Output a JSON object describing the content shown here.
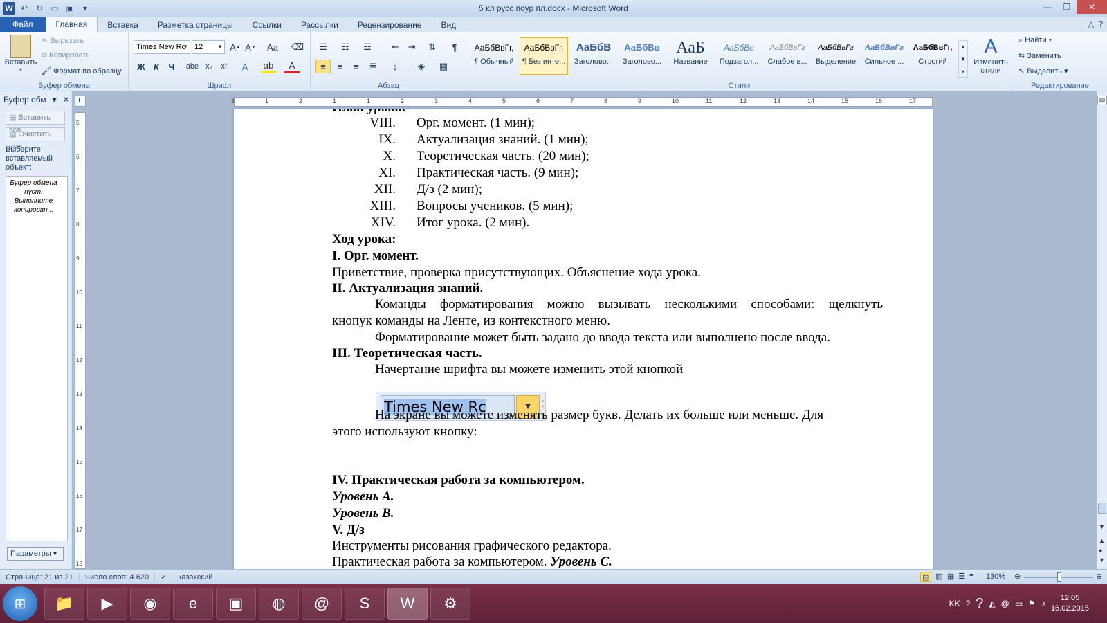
{
  "window": {
    "title": "5 кл русс поур пл.docx - Microsoft Word",
    "app_icon": "W"
  },
  "tabs": [
    {
      "label": "Файл"
    },
    {
      "label": "Главная"
    },
    {
      "label": "Вставка"
    },
    {
      "label": "Разметка страницы"
    },
    {
      "label": "Ссылки"
    },
    {
      "label": "Рассылки"
    },
    {
      "label": "Рецензирование"
    },
    {
      "label": "Вид"
    }
  ],
  "ribbon": {
    "clipboard": {
      "paste": "Вставить",
      "cut": "Вырезать",
      "copy": "Копировать",
      "format_painter": "Формат по образцу",
      "label": "Буфер обмена"
    },
    "font": {
      "name": "Times New Rc",
      "size": "12",
      "bold": "Ж",
      "italic": "К",
      "underline": "Ч",
      "strike": "abe",
      "sub": "x₂",
      "sup": "x²",
      "label": "Шрифт"
    },
    "paragraph": {
      "label": "Абзац"
    },
    "styles": {
      "items": [
        {
          "sample": "АаБбВвГг,",
          "name": "¶ Обычный"
        },
        {
          "sample": "АаБбВвГг,",
          "name": "¶ Без инте..."
        },
        {
          "sample": "АаБбВ",
          "name": "Заголово..."
        },
        {
          "sample": "АаБбВв",
          "name": "Заголово..."
        },
        {
          "sample": "АаБ",
          "name": "Название"
        },
        {
          "sample": "АаБбВе",
          "name": "Подзагол..."
        },
        {
          "sample": "АаБбВвГг",
          "name": "Слабое в..."
        },
        {
          "sample": "АаБбВвГг",
          "name": "Выделение"
        },
        {
          "sample": "АаБбВвГг",
          "name": "Сильное ..."
        },
        {
          "sample": "АаБбВвГг,",
          "name": "Строгий"
        }
      ],
      "change": "Изменить стили",
      "label": "Стили"
    },
    "editing": {
      "find": "Найти",
      "replace": "Заменить",
      "select": "Выделить",
      "label": "Редактирование"
    }
  },
  "pane": {
    "title": "Буфер обм",
    "paste_all": "Вставить все",
    "clear_all": "Очистить все",
    "hint": "Выберите вставляемый объект:",
    "empty": "Буфер обмена пуст. Выполните копирован...",
    "params": "Параметры"
  },
  "ruler": {
    "h_labels": [
      "3",
      "1",
      "2",
      "1",
      "1",
      "2",
      "3",
      "4",
      "5",
      "6",
      "7",
      "8",
      "9",
      "10",
      "11",
      "12",
      "13",
      "14",
      "15",
      "16",
      "17"
    ],
    "v_labels": [
      "5",
      "6",
      "7",
      "8",
      "9",
      "10",
      "11",
      "12",
      "13",
      "14",
      "15",
      "16",
      "17",
      "18"
    ]
  },
  "document": {
    "top_cut": "План урока:",
    "plan": [
      {
        "num": "VIII.",
        "text": "Орг. момент. (1 мин);"
      },
      {
        "num": "IX.",
        "text": "Актуализация знаний. (1 мин);"
      },
      {
        "num": "X.",
        "text": "Теоретическая часть. (20 мин);"
      },
      {
        "num": "XI.",
        "text": "Практическая часть. (9 мин);"
      },
      {
        "num": "XII.",
        "text": "Д/з (2 мин);"
      },
      {
        "num": "XIII.",
        "text": "Вопросы учеников. (5 мин);"
      },
      {
        "num": "XIV.",
        "text": "Итог урока. (2 мин)."
      }
    ],
    "course_heading": "Ход урока:",
    "h1": "I.  Орг. момент.",
    "p1": "Приветствие, проверка присутствующих. Объяснение хода урока.",
    "h2": "II.  Актуализация знаний.",
    "p2a": "Команды форматирования можно вызывать несколькими способами: щелкнуть",
    "p2b": "кнопук команды на Ленте, из контекстного меню.",
    "p2c": "Форматирование может быть задано до ввода текста или выполнено после ввода.",
    "h3": "III.  Теоретическая часть.",
    "p3": "Начертание шрифта вы можете изменить этой кнопкой",
    "font_picture": "Times New Rc",
    "p4a": "На экране вы можете изменять размер букв. Делать их больше или меньше. Для",
    "p4b": "этого используют кнопку:",
    "h4": "IV. Практическая работа за компьютером.",
    "level_a": "Уровень А.",
    "level_b": "Уровень В.",
    "h5": "V. Д/з",
    "p5": "Инструменты рисования графического редактора.",
    "p6_plain": "Практическая работа за компьютером. ",
    "p6_bold": "Уровень С."
  },
  "status": {
    "page": "Страница: 21 из 21",
    "words": "Число слов: 4 620",
    "lang": "казахский",
    "zoom": "130%"
  },
  "taskbar": {
    "lang": "KK",
    "time": "12:05",
    "date": "16.02.2015"
  },
  "colors": {
    "file_tab": "#2a62b3",
    "taskbar": "#6b2741",
    "close_button": "#c75050",
    "selected_style": "#fdf3c6"
  }
}
